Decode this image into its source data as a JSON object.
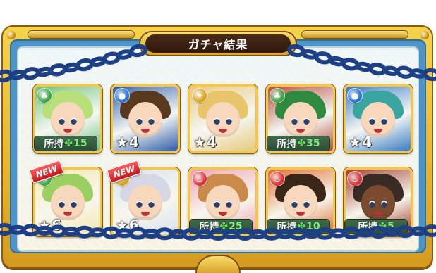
{
  "title": "ガチャ結果",
  "star_glyph": "★",
  "owned_label": "所持",
  "clover_glyph": "✤",
  "new_label": "NEW",
  "results": [
    {
      "element": "wood",
      "element_color": "#3fa84a",
      "hair_color": "#b8e07a",
      "bg": "#6fc27a",
      "rarity": "",
      "owned": "15",
      "is_new": false
    },
    {
      "element": "water",
      "element_color": "#2a77d6",
      "hair_color": "#5a3a1e",
      "bg": "#2f5da8",
      "rarity": "4",
      "owned": "",
      "is_new": false
    },
    {
      "element": "light",
      "element_color": "#d9a520",
      "hair_color": "#e8c56a",
      "bg": "#e7c97c",
      "rarity": "4",
      "owned": "",
      "is_new": false
    },
    {
      "element": "wood",
      "element_color": "#3fa84a",
      "hair_color": "#2e8a3e",
      "bg": "#b84a3a",
      "rarity": "",
      "owned": "35",
      "is_new": false
    },
    {
      "element": "water",
      "element_color": "#2a77d6",
      "hair_color": "#3aa4a0",
      "bg": "#3a7bc2",
      "rarity": "4",
      "owned": "",
      "is_new": false
    },
    {
      "element": "wood",
      "element_color": "#3fa84a",
      "hair_color": "#9ccf62",
      "bg": "#f3e8b0",
      "rarity": "6",
      "owned": "",
      "is_new": true
    },
    {
      "element": "light",
      "element_color": "#d9a520",
      "hair_color": "#d6d6e4",
      "bg": "#d8e2ee",
      "rarity": "6",
      "owned": "",
      "is_new": true
    },
    {
      "element": "fire",
      "element_color": "#d8353a",
      "hair_color": "#c98a4a",
      "bg": "#f0a0b4",
      "rarity": "",
      "owned": "25",
      "is_new": false
    },
    {
      "element": "fire",
      "element_color": "#d8353a",
      "hair_color": "#3a2616",
      "bg": "#e06a2a",
      "rarity": "",
      "owned": "10",
      "is_new": false
    },
    {
      "element": "fire",
      "element_color": "#d8353a",
      "hair_color": "#3a2a24",
      "bg": "#a03a2a",
      "rarity": "",
      "owned": "5",
      "is_new": false,
      "dark_skin": true
    }
  ]
}
